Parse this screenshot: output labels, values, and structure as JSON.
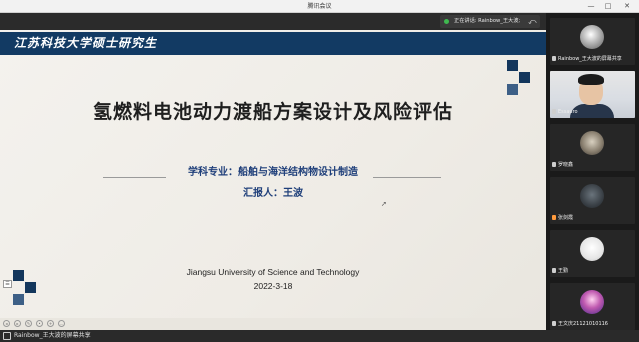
{
  "window": {
    "title": "腾讯会议",
    "minimize": "—",
    "maximize": "□",
    "close": "✕"
  },
  "share_bar": {
    "speaking_text": "正在讲话: Rainbow_王大波;",
    "back_icon": "back-arrow-icon"
  },
  "slide": {
    "header": "江苏科技大学硕士研究生",
    "title": "氢燃料电池动力渡船方案设计及风险评估",
    "major": "学科专业：船舶与海洋结构物设计制造",
    "reporter": "汇报人：王波",
    "university": "Jiangsu University of Science and Technology",
    "date": "2022-3-18",
    "accent_color": "#13365c"
  },
  "bottom_bar": {
    "share_label": "Rainbow_王大波的屏幕共享"
  },
  "participants": [
    {
      "name": "Rainbow_王大波的屏幕共享",
      "kind": "avatar",
      "color": "#9a9a9a"
    },
    {
      "name": "Essauro",
      "kind": "video",
      "color": "#e7c4a4"
    },
    {
      "name": "罗晓鑫",
      "kind": "avatar",
      "color": "#8a8070"
    },
    {
      "name": "张剑霞",
      "kind": "avatar",
      "color": "#3a4046",
      "mic_color": "#ff9a3c"
    },
    {
      "name": "王勤",
      "kind": "avatar",
      "color": "#f0f0f0"
    },
    {
      "name": "王文庆21121010116",
      "kind": "avatar",
      "color": "#c05ab0"
    }
  ]
}
